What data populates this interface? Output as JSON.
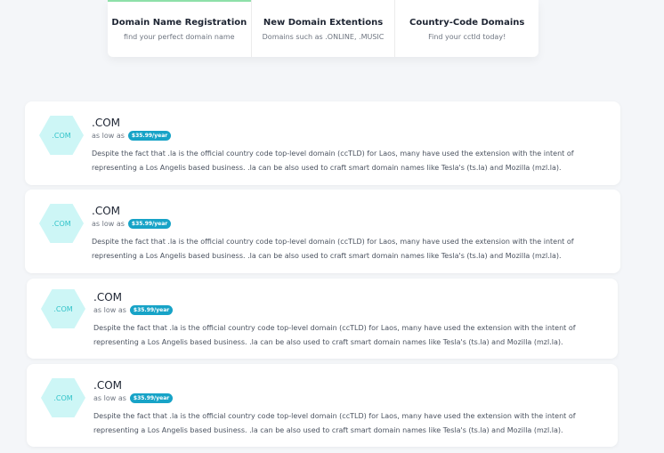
{
  "tabs": [
    {
      "title": "Domain Name Registration",
      "subtitle": "find your perfect domain name"
    },
    {
      "title": "New Domain Extentions",
      "subtitle": "Domains such as .ONLINE, .MUSIC"
    },
    {
      "title": "Country-Code Domains",
      "subtitle": "Find your cctld today!"
    }
  ],
  "cards": [
    {
      "badge": ".COM",
      "name": ".COM",
      "as_low_as": "as low as",
      "price": "$35.99/year",
      "desc_line1": "Despite the fact that .la is the official country code top-level domain (ccTLD) for Laos, many have used the extension with the intent of",
      "desc_line2": "representing a Los Angelis based business. .la can be also used to craft smart domain names like Tesla's (ts.la) and Mozilla (mzl.la)."
    },
    {
      "badge": ".COM",
      "name": ".COM",
      "as_low_as": "as low as",
      "price": "$35.99/year",
      "desc_line1": "Despite the fact that .la is the official country code top-level domain (ccTLD) for Laos, many have used the extension with the intent of",
      "desc_line2": "representing a Los Angelis based business. .la can be also used to craft smart domain names like Tesla's (ts.la) and Mozilla (mzl.la)."
    },
    {
      "badge": ".COM",
      "name": ".COM",
      "as_low_as": "as low as",
      "price": "$35.99/year",
      "desc_line1": "Despite the fact that .la is the official country code top-level domain (ccTLD) for Laos, many have used the extension with the intent of",
      "desc_line2": "representing a Los Angelis based business. .la can be also used to craft smart domain names like Tesla's (ts.la) and Mozilla (mzl.la)."
    },
    {
      "badge": ".COM",
      "name": ".COM",
      "as_low_as": "as low as",
      "price": "$35.99/year",
      "desc_line1": "Despite the fact that .la is the official country code top-level domain (ccTLD) for Laos, many have used the extension with the intent of",
      "desc_line2": "representing a Los Angelis based business. .la can be also used to craft smart domain names like Tesla's (ts.la) and Mozilla (mzl.la)."
    }
  ],
  "colors": {
    "accent": "#17a3c7",
    "hex_bg": "#cdf6f6",
    "hex_text": "#32c3c9",
    "active_tab": "#8ee0a9"
  }
}
